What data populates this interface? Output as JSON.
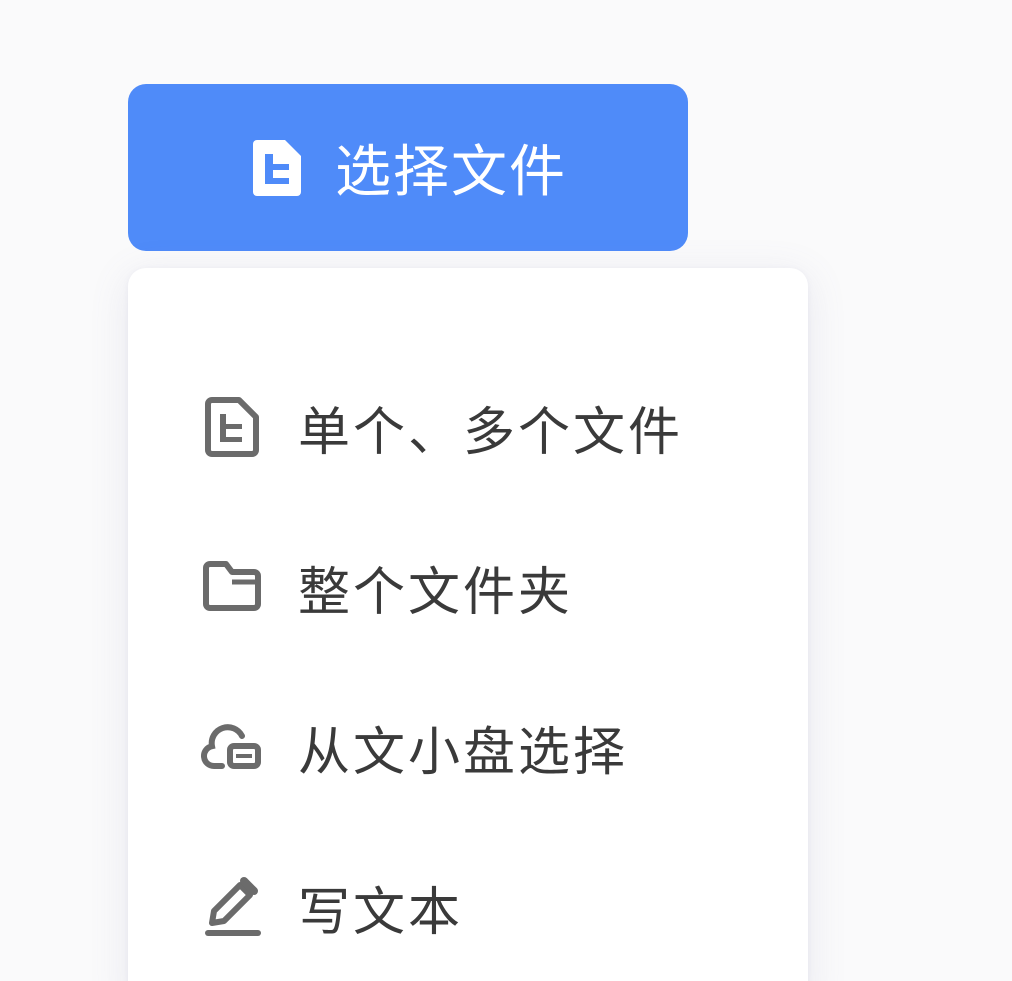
{
  "select_button": {
    "label": "选择文件",
    "icon": "document-icon"
  },
  "menu": {
    "items": [
      {
        "label": "单个、多个文件",
        "icon": "document-icon"
      },
      {
        "label": "整个文件夹",
        "icon": "folder-icon"
      },
      {
        "label": "从文小盘选择",
        "icon": "cloud-drive-icon"
      },
      {
        "label": "写文本",
        "icon": "pencil-icon"
      }
    ]
  },
  "colors": {
    "accent": "#4f8bf9",
    "menu_text": "#3a3a3a",
    "menu_icon": "#6b6b6b",
    "background": "#fafafb"
  }
}
